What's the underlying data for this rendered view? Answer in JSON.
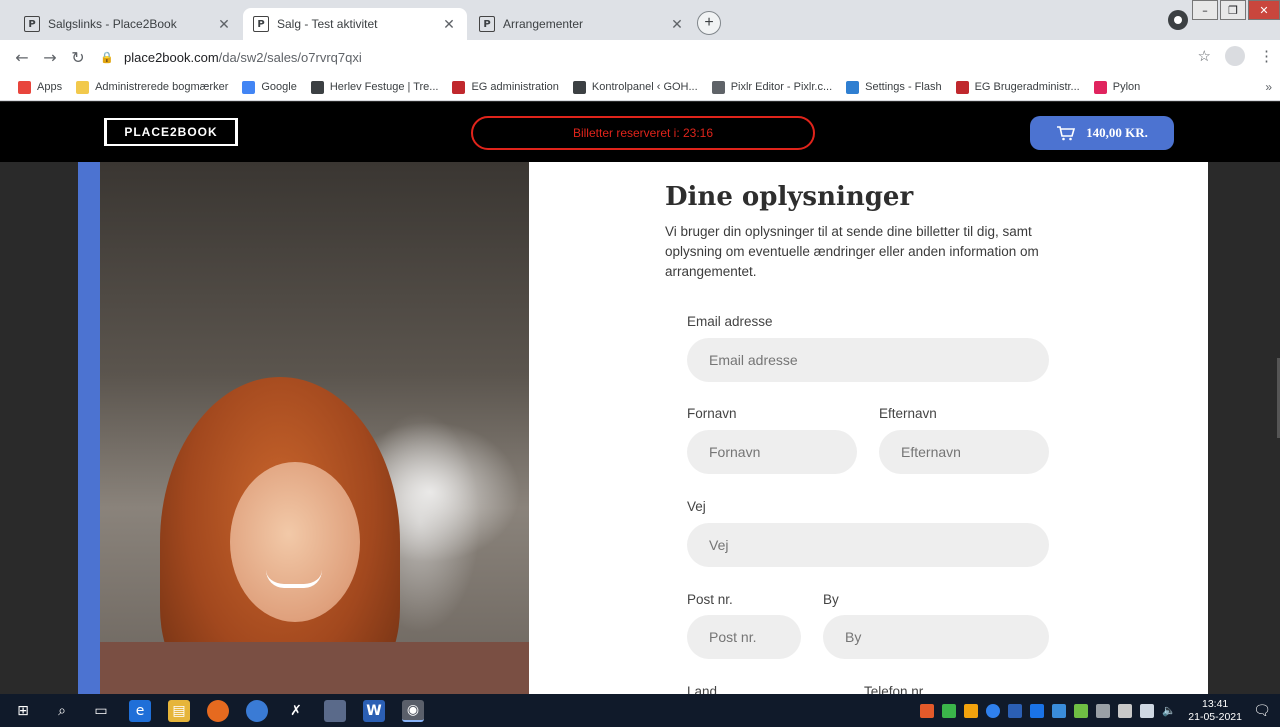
{
  "browser": {
    "tabs": [
      {
        "title": "Salgslinks - Place2Book",
        "favicon": "P"
      },
      {
        "title": "Salg - Test aktivitet",
        "favicon": "P"
      },
      {
        "title": "Arrangementer",
        "favicon": "P"
      }
    ],
    "new_tab_label": "+",
    "url_host": "place2book.com",
    "url_path": "/da/sw2/sales/o7rvrq7qxi",
    "bookmarks": [
      {
        "label": "Apps",
        "icon": "apps-grid-icon",
        "color": "#e8453c"
      },
      {
        "label": "Administrerede bogmærker",
        "icon": "folder-icon",
        "color": "#f2c94c"
      },
      {
        "label": "Google",
        "icon": "google-icon",
        "color": "#4285f4"
      },
      {
        "label": "Herlev Festuge | Tre...",
        "icon": "book-icon",
        "color": "#3c4043"
      },
      {
        "label": "EG administration",
        "icon": "eg-icon",
        "color": "#c0282d"
      },
      {
        "label": "Kontrolpanel ‹ GOH...",
        "icon": "wordpress-icon",
        "color": "#3c4043"
      },
      {
        "label": "Pixlr Editor - Pixlr.c...",
        "icon": "pixlr-icon",
        "color": "#5f6368"
      },
      {
        "label": "Settings - Flash",
        "icon": "gear-icon",
        "color": "#2f7fd1"
      },
      {
        "label": "EG Brugeradministr...",
        "icon": "eg-icon",
        "color": "#c0282d"
      },
      {
        "label": "Pylon",
        "icon": "pylon-icon",
        "color": "#e0245e"
      }
    ],
    "bookmarks_more": "»"
  },
  "header": {
    "logo_text": "PLACE2BOOK",
    "timer_text": "Billetter reserveret i: 23:16",
    "cart_amount": "140,00 KR.",
    "accent_color": "#4c73d1",
    "timer_color": "#e0241b"
  },
  "form": {
    "title": "Dine oplysninger",
    "description": "Vi bruger din oplysninger til at sende dine billetter til dig, samt oplysning om eventuelle ændringer eller anden information om arrangementet.",
    "email_label": "Email adresse",
    "email_placeholder": "Email adresse",
    "firstname_label": "Fornavn",
    "firstname_placeholder": "Fornavn",
    "lastname_label": "Efternavn",
    "lastname_placeholder": "Efternavn",
    "street_label": "Vej",
    "street_placeholder": "Vej",
    "zip_label": "Post nr.",
    "zip_placeholder": "Post nr.",
    "city_label": "By",
    "city_placeholder": "By",
    "country_label": "Land",
    "phone_label": "Telefon nr."
  },
  "taskbar": {
    "time": "13:41",
    "date": "21-05-2021"
  }
}
